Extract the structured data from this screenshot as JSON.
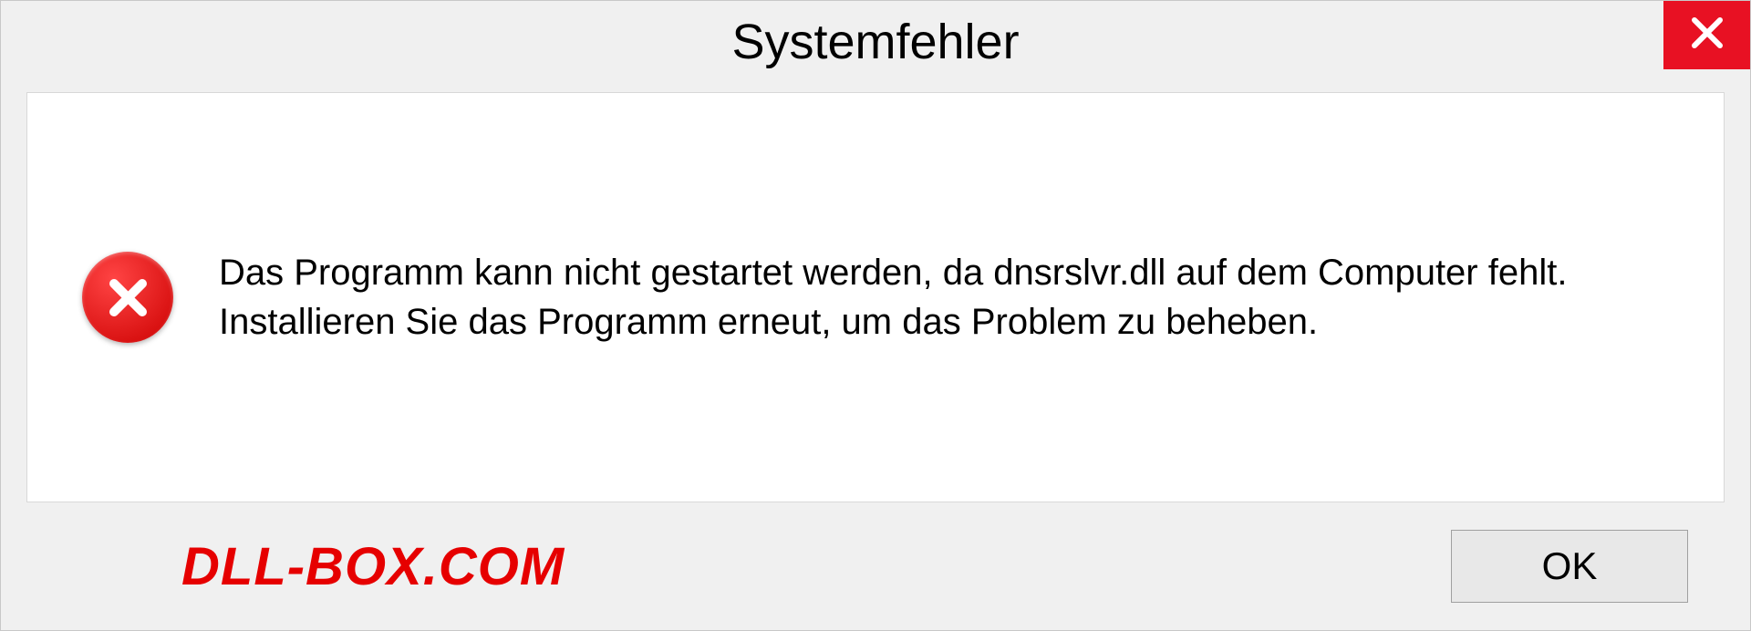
{
  "dialog": {
    "title": "Systemfehler",
    "message": "Das Programm kann nicht gestartet werden, da dnsrslvr.dll auf dem Computer fehlt. Installieren Sie das Programm erneut, um das Problem zu beheben.",
    "ok_label": "OK"
  },
  "watermark": "DLL-BOX.COM"
}
